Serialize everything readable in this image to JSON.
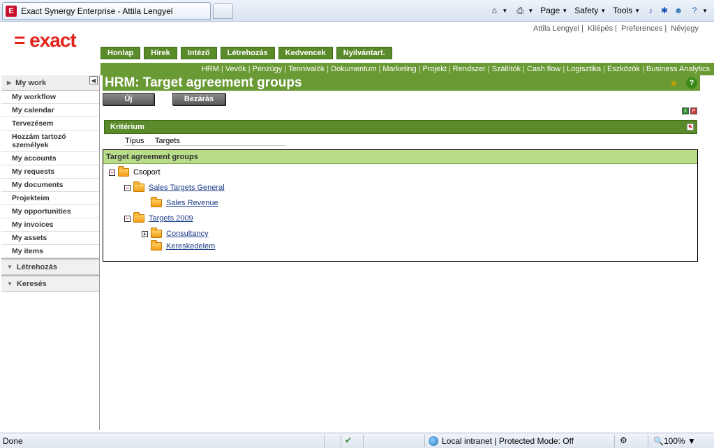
{
  "browser": {
    "tab_title": "Exact Synergy Enterprise - Attila Lengyel",
    "tab_icon_letter": "E",
    "commands": {
      "page": "Page",
      "safety": "Safety",
      "tools": "Tools"
    },
    "status": {
      "done": "Done",
      "zone": "Local intranet | Protected Mode: Off",
      "zoom": "100%"
    }
  },
  "header": {
    "logo": "= exact",
    "user_links": [
      "Attila Lengyel",
      "Kilépés",
      "Preferences",
      "Névjegy"
    ]
  },
  "main_nav": [
    "Honlap",
    "Hírek",
    "Intéző",
    "Létrehozás",
    "Kedvencek",
    "Nyilvántart."
  ],
  "sub_nav": [
    "HRM",
    "Vevők",
    "Pénzügy",
    "Tennivalók",
    "Dokumentum",
    "Marketing",
    "Projekt",
    "Rendszer",
    "Szállítók",
    "Cash flow",
    "Logisztika",
    "Eszközök",
    "Business Analytics"
  ],
  "sidebar": {
    "header": "My work",
    "items": [
      "My workflow",
      "My calendar",
      "Tervezésem",
      "Hozzám tartozó személyek",
      "My accounts",
      "My requests",
      "My documents",
      "Projekteim",
      "My opportunities",
      "My invoices",
      "My assets",
      "My items"
    ],
    "sections": [
      "Létrehozás",
      "Keresés"
    ]
  },
  "page": {
    "title": "HRM: Target agreement groups",
    "buttons": {
      "new": "Új",
      "close": "Bezárás"
    },
    "criteria": {
      "header": "Kritérium",
      "label": "Típus",
      "value": "Targets"
    },
    "groups": {
      "header": "Target agreement groups",
      "root": "Csoport",
      "sales_general": "Sales Targets General",
      "sales_revenue": "Sales Revenue",
      "targets_2009": "Targets 2009",
      "consultancy": "Consultancy",
      "kereskedelem": "Kereskedelem"
    }
  }
}
